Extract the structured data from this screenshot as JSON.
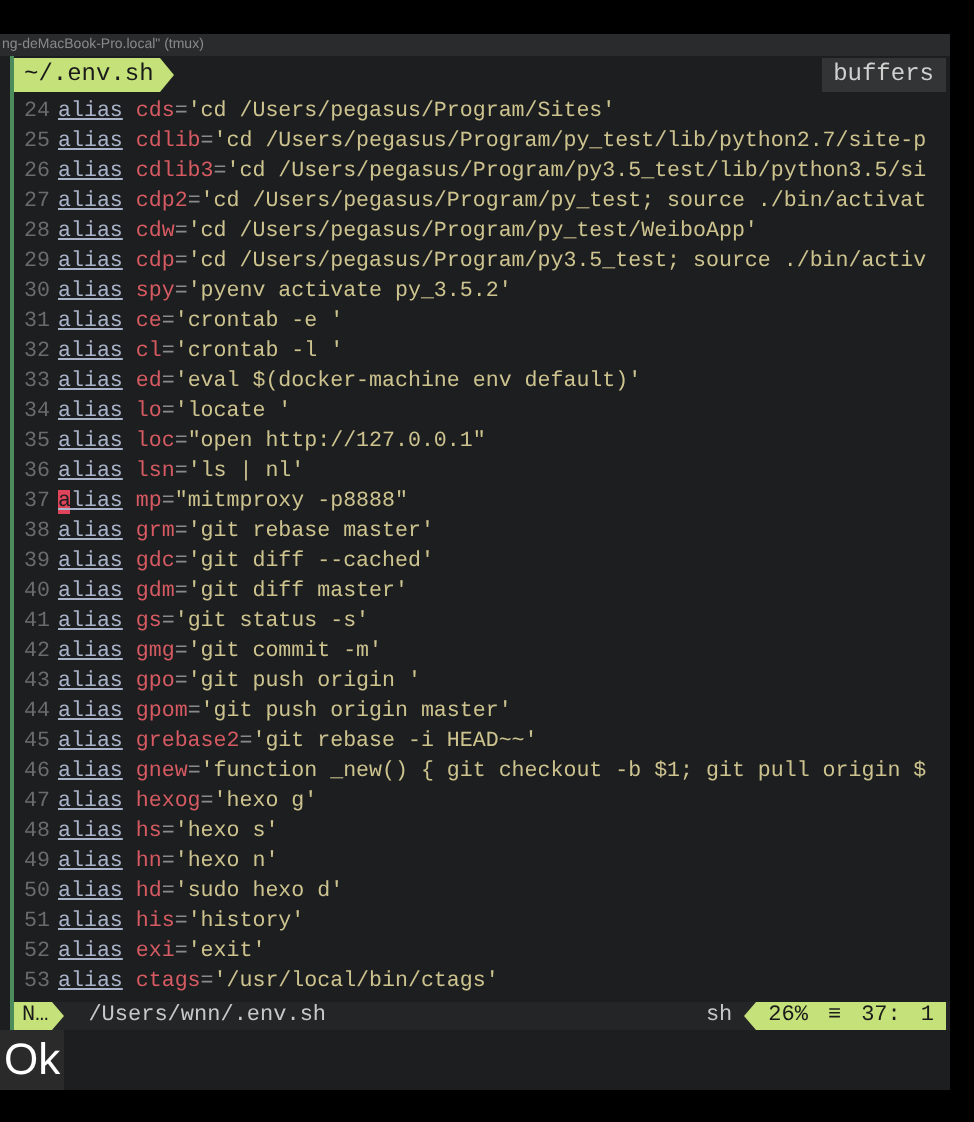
{
  "window": {
    "title": "ng-deMacBook-Pro.local\" (tmux)"
  },
  "tabline": {
    "file_tab": "~/.env.sh",
    "buffers_label": "buffers"
  },
  "lines": [
    {
      "number": "24",
      "keyword": "alias",
      "name": "cds",
      "value": "'cd /Users/pegasus/Program/Sites'",
      "cursor": false
    },
    {
      "number": "25",
      "keyword": "alias",
      "name": "cdlib",
      "value": "'cd /Users/pegasus/Program/py_test/lib/python2.7/site-p",
      "cursor": false
    },
    {
      "number": "26",
      "keyword": "alias",
      "name": "cdlib3",
      "value": "'cd /Users/pegasus/Program/py3.5_test/lib/python3.5/si",
      "cursor": false
    },
    {
      "number": "27",
      "keyword": "alias",
      "name": "cdp2",
      "value": "'cd /Users/pegasus/Program/py_test; source ./bin/activat",
      "cursor": false
    },
    {
      "number": "28",
      "keyword": "alias",
      "name": "cdw",
      "value": "'cd /Users/pegasus/Program/py_test/WeiboApp'",
      "cursor": false
    },
    {
      "number": "29",
      "keyword": "alias",
      "name": "cdp",
      "value": "'cd /Users/pegasus/Program/py3.5_test; source ./bin/activ",
      "cursor": false
    },
    {
      "number": "30",
      "keyword": "alias",
      "name": "spy",
      "value": "'pyenv activate py_3.5.2'",
      "cursor": false
    },
    {
      "number": "31",
      "keyword": "alias",
      "name": "ce",
      "value": "'crontab -e '",
      "cursor": false
    },
    {
      "number": "32",
      "keyword": "alias",
      "name": "cl",
      "value": "'crontab -l '",
      "cursor": false
    },
    {
      "number": "33",
      "keyword": "alias",
      "name": "ed",
      "value": "'eval $(docker-machine env default)'",
      "cursor": false
    },
    {
      "number": "34",
      "keyword": "alias",
      "name": "lo",
      "value": "'locate '",
      "cursor": false
    },
    {
      "number": "35",
      "keyword": "alias",
      "name": "loc",
      "value": "\"open http://127.0.0.1\"",
      "cursor": false
    },
    {
      "number": "36",
      "keyword": "alias",
      "name": "lsn",
      "value": "'ls | nl'",
      "cursor": false
    },
    {
      "number": "37",
      "keyword": "alias",
      "name": "mp",
      "value": "\"mitmproxy -p8888\"",
      "cursor": true
    },
    {
      "number": "38",
      "keyword": "alias",
      "name": "grm",
      "value": "'git rebase master'",
      "cursor": false
    },
    {
      "number": "39",
      "keyword": "alias",
      "name": "gdc",
      "value": "'git diff --cached'",
      "cursor": false
    },
    {
      "number": "40",
      "keyword": "alias",
      "name": "gdm",
      "value": "'git diff master'",
      "cursor": false
    },
    {
      "number": "41",
      "keyword": "alias",
      "name": "gs",
      "value": "'git status -s'",
      "cursor": false
    },
    {
      "number": "42",
      "keyword": "alias",
      "name": "gmg",
      "value": "'git commit -m'",
      "cursor": false
    },
    {
      "number": "43",
      "keyword": "alias",
      "name": "gpo",
      "value": "'git push origin '",
      "cursor": false
    },
    {
      "number": "44",
      "keyword": "alias",
      "name": "gpom",
      "value": "'git push origin master'",
      "cursor": false
    },
    {
      "number": "45",
      "keyword": "alias",
      "name": "grebase2",
      "value": "'git rebase -i HEAD~~'",
      "cursor": false
    },
    {
      "number": "46",
      "keyword": "alias",
      "name": "gnew",
      "value": "'function _new() { git checkout -b $1; git pull origin $",
      "cursor": false
    },
    {
      "number": "47",
      "keyword": "alias",
      "name": "hexog",
      "value": "'hexo g'",
      "cursor": false
    },
    {
      "number": "48",
      "keyword": "alias",
      "name": "hs",
      "value": "'hexo s'",
      "cursor": false
    },
    {
      "number": "49",
      "keyword": "alias",
      "name": "hn",
      "value": "'hexo n'",
      "cursor": false
    },
    {
      "number": "50",
      "keyword": "alias",
      "name": "hd",
      "value": "'sudo hexo d'",
      "cursor": false
    },
    {
      "number": "51",
      "keyword": "alias",
      "name": "his",
      "value": "'history'",
      "cursor": false
    },
    {
      "number": "52",
      "keyword": "alias",
      "name": "exi",
      "value": "'exit'",
      "cursor": false
    },
    {
      "number": "53",
      "keyword": "alias",
      "name": "ctags",
      "value": "'/usr/local/bin/ctags'",
      "cursor": false
    }
  ],
  "status_line": {
    "mode": "N…",
    "path": "/Users/wnn/.env.sh",
    "filetype": "sh",
    "percent": "26%",
    "separator": "≡",
    "line": "37:",
    "column": "1"
  },
  "caption": "Ok",
  "operator": "="
}
